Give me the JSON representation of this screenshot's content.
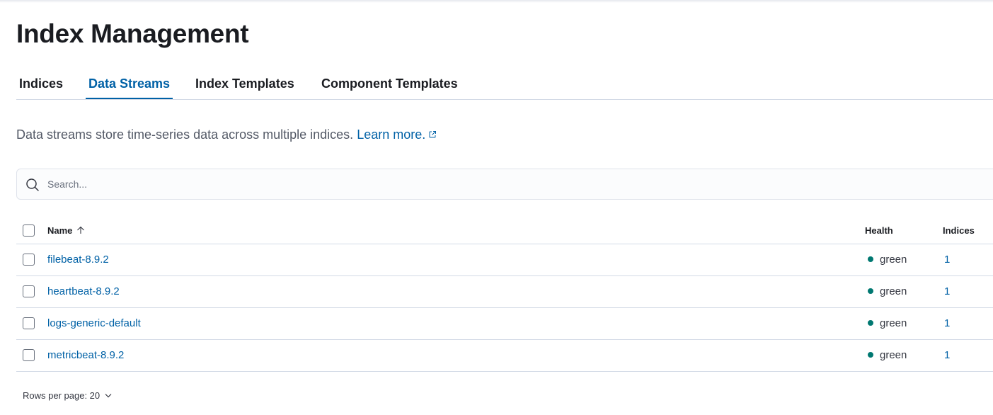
{
  "page": {
    "title": "Index Management"
  },
  "tabs": [
    {
      "label": "Indices",
      "selected": false
    },
    {
      "label": "Data Streams",
      "selected": true
    },
    {
      "label": "Index Templates",
      "selected": false
    },
    {
      "label": "Component Templates",
      "selected": false
    }
  ],
  "description": {
    "text": "Data streams store time-series data across multiple indices.",
    "link_label": "Learn more.",
    "link_icon": "external-link-icon"
  },
  "search": {
    "placeholder": "Search...",
    "value": "",
    "icon": "search-icon"
  },
  "table": {
    "columns": {
      "name": "Name",
      "health": "Health",
      "indices": "Indices"
    },
    "sort": {
      "column": "Name",
      "direction": "ascending",
      "icon": "arrow-up-icon"
    },
    "rows": [
      {
        "name": "filebeat-8.9.2",
        "health": "green",
        "indices": "1"
      },
      {
        "name": "heartbeat-8.9.2",
        "health": "green",
        "indices": "1"
      },
      {
        "name": "logs-generic-default",
        "health": "green",
        "indices": "1"
      },
      {
        "name": "metricbeat-8.9.2",
        "health": "green",
        "indices": "1"
      }
    ]
  },
  "pagination": {
    "rows_per_page_label": "Rows per page: 20",
    "icon": "chevron-down-icon"
  },
  "colors": {
    "accent": "#0061a6",
    "health_green": "#007871",
    "title_text": "#1a1c21",
    "border": "#d3dae6"
  }
}
